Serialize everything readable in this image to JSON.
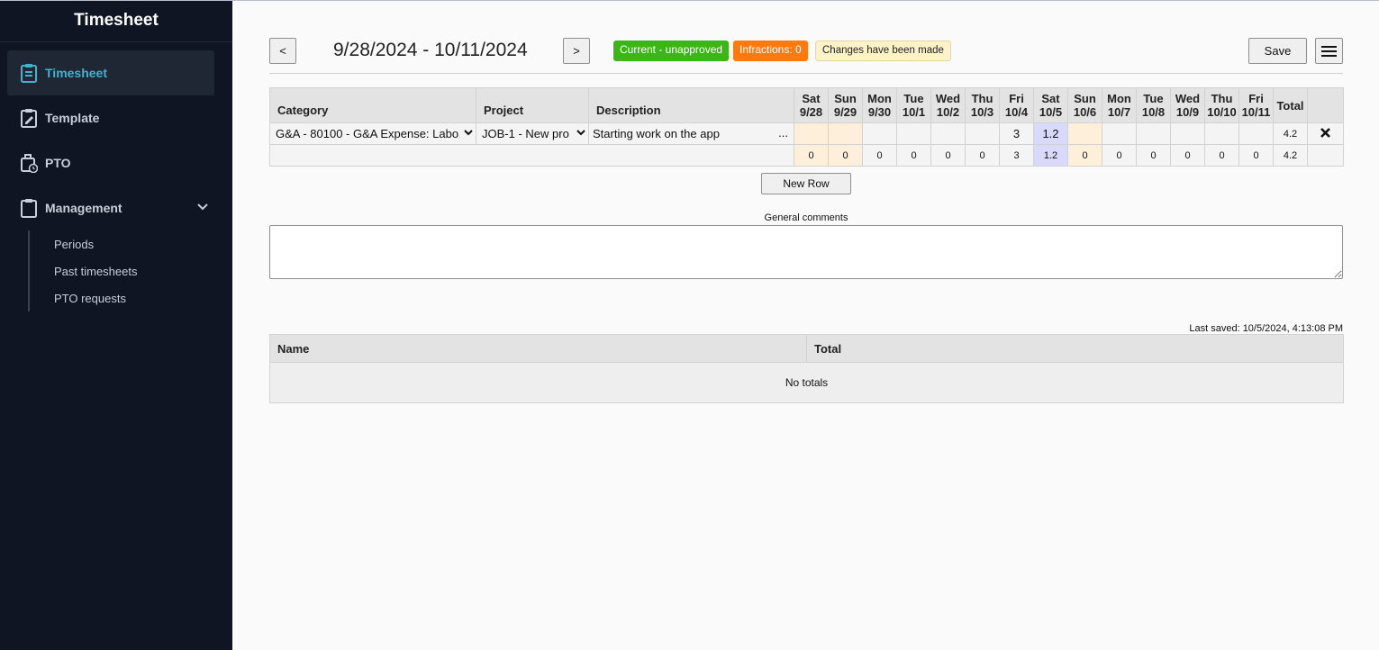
{
  "sidebar": {
    "brand": "Timesheet",
    "items": [
      {
        "label": "Timesheet",
        "icon": "clipboard-list-icon",
        "active": true
      },
      {
        "label": "Template",
        "icon": "clipboard-edit-icon"
      },
      {
        "label": "PTO",
        "icon": "briefcase-clock-icon"
      },
      {
        "label": "Management",
        "icon": "clipboard-icon",
        "expanded": true
      }
    ],
    "subitems": [
      "Periods",
      "Past timesheets",
      "PTO requests"
    ]
  },
  "header": {
    "prev_label": "<",
    "next_label": ">",
    "period": "9/28/2024 - 10/11/2024",
    "status_badge": "Current - unapproved",
    "infractions_badge": "Infractions: 0",
    "changes_badge": "Changes have been made",
    "save_label": "Save",
    "menu_icon": "hamburger-menu-icon"
  },
  "timesheet": {
    "headers": {
      "category": "Category",
      "project": "Project",
      "description": "Description",
      "total": "Total"
    },
    "days": [
      {
        "dow": "Sat",
        "date": "9/28"
      },
      {
        "dow": "Sun",
        "date": "9/29"
      },
      {
        "dow": "Mon",
        "date": "9/30"
      },
      {
        "dow": "Tue",
        "date": "10/1"
      },
      {
        "dow": "Wed",
        "date": "10/2"
      },
      {
        "dow": "Thu",
        "date": "10/3"
      },
      {
        "dow": "Fri",
        "date": "10/4"
      },
      {
        "dow": "Sat",
        "date": "10/5"
      },
      {
        "dow": "Sun",
        "date": "10/6"
      },
      {
        "dow": "Mon",
        "date": "10/7"
      },
      {
        "dow": "Tue",
        "date": "10/8"
      },
      {
        "dow": "Wed",
        "date": "10/9"
      },
      {
        "dow": "Thu",
        "date": "10/10"
      },
      {
        "dow": "Fri",
        "date": "10/11"
      }
    ],
    "row": {
      "category": "G&A - 80100 - G&A Expense: Labo",
      "project": "JOB-1 - New pro",
      "description": "Starting work on the app",
      "description_more": "...",
      "hours": [
        "",
        "",
        "",
        "",
        "",
        "",
        "3",
        "1.2",
        "",
        "",
        "",
        "",
        "",
        ""
      ],
      "total": "4.2",
      "delete_icon": "close-x-icon"
    },
    "totals_row": {
      "hours": [
        "0",
        "0",
        "0",
        "0",
        "0",
        "0",
        "3",
        "1.2",
        "0",
        "0",
        "0",
        "0",
        "0",
        "0"
      ],
      "total": "4.2"
    },
    "new_row_label": "New Row"
  },
  "comments": {
    "label": "General comments",
    "value": ""
  },
  "last_saved": "Last saved: 10/5/2024, 4:13:08 PM",
  "totals_table": {
    "headers": [
      "Name",
      "Total"
    ],
    "empty_text": "No totals"
  },
  "colors": {
    "sidebar_bg": "#0f1522",
    "accent": "#3fb3cc",
    "status_green": "#3cb517",
    "infractions_orange": "#ff7a0e",
    "changes_yellow": "#fdf2c8",
    "weekend": "#fdefd9",
    "today": "#d9d9fb"
  }
}
